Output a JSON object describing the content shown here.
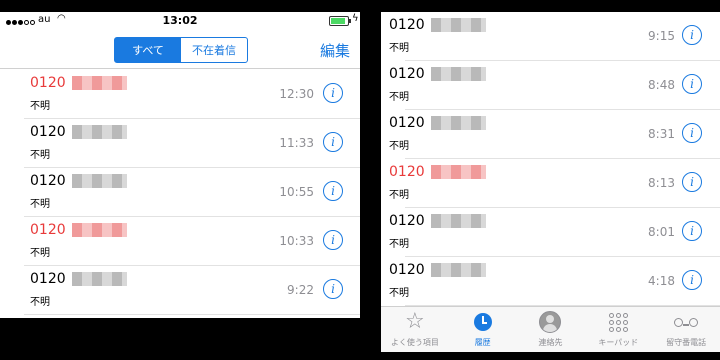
{
  "status_bar": {
    "carrier": "au",
    "time": "13:02"
  },
  "header": {
    "segments": [
      "すべて",
      "不在着信"
    ],
    "edit_label": "編集"
  },
  "left_calls": [
    {
      "number": "0120",
      "label": "不明",
      "time": "12:30",
      "missed": true
    },
    {
      "number": "0120",
      "label": "不明",
      "time": "11:33",
      "missed": false
    },
    {
      "number": "0120",
      "label": "不明",
      "time": "10:55",
      "missed": false
    },
    {
      "number": "0120",
      "label": "不明",
      "time": "10:33",
      "missed": true
    },
    {
      "number": "0120",
      "label": "不明",
      "time": "9:22",
      "missed": false
    }
  ],
  "right_calls": [
    {
      "number": "0120",
      "label": "不明",
      "time": "9:15",
      "missed": false
    },
    {
      "number": "0120",
      "label": "不明",
      "time": "8:48",
      "missed": false
    },
    {
      "number": "0120",
      "label": "不明",
      "time": "8:31",
      "missed": false
    },
    {
      "number": "0120",
      "label": "不明",
      "time": "8:13",
      "missed": true
    },
    {
      "number": "0120",
      "label": "不明",
      "time": "8:01",
      "missed": false
    },
    {
      "number": "0120",
      "label": "不明",
      "time": "4:18",
      "missed": false
    }
  ],
  "tabbar": [
    {
      "label": "よく使う項目",
      "icon": "star-icon"
    },
    {
      "label": "履歴",
      "icon": "clock-icon",
      "active": true
    },
    {
      "label": "連絡先",
      "icon": "contacts-icon"
    },
    {
      "label": "キーパッド",
      "icon": "keypad-icon"
    },
    {
      "label": "留守番電話",
      "icon": "voicemail-icon"
    }
  ],
  "colors": {
    "accent": "#1a7ae0",
    "missed": "#e83a3a"
  }
}
